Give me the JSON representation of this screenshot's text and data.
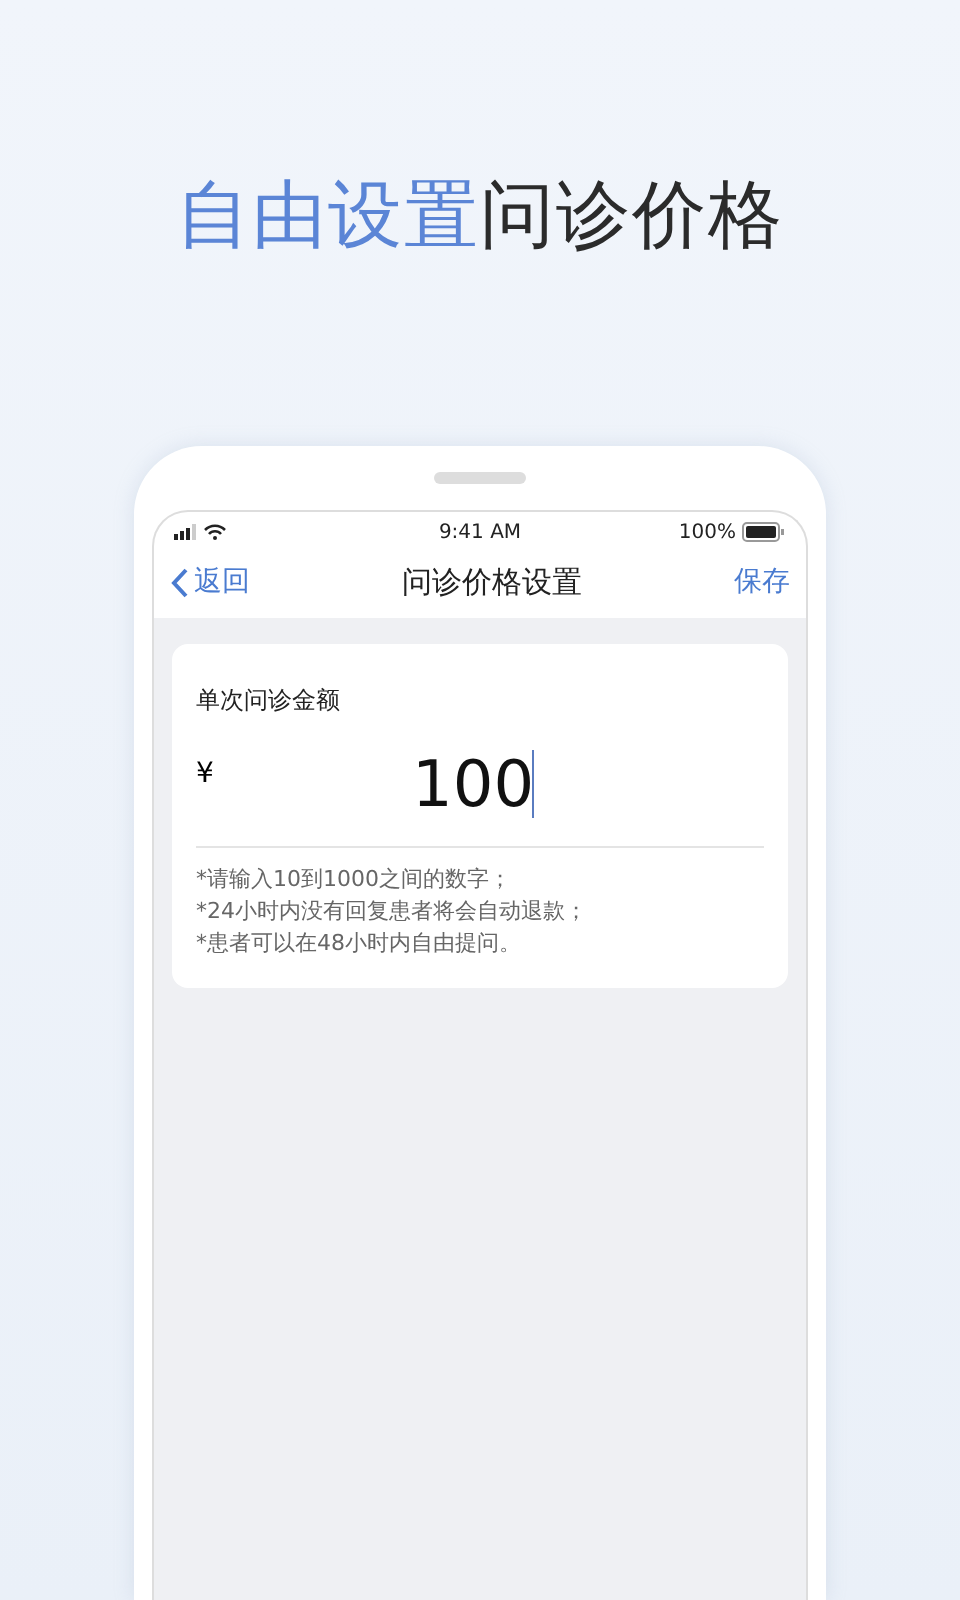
{
  "headline": {
    "highlight": "自由设置",
    "rest": "问诊价格"
  },
  "status_bar": {
    "time": "9:41 AM",
    "battery": "100%"
  },
  "nav": {
    "back": "返回",
    "title": "问诊价格设置",
    "action": "保存"
  },
  "card": {
    "label": "单次问诊金额",
    "currency": "¥",
    "amount": "100",
    "notes": [
      "*请输入10到1000之间的数字；",
      "*24小时内没有回复患者将会自动退款；",
      "*患者可以在48小时内自由提问。"
    ]
  }
}
